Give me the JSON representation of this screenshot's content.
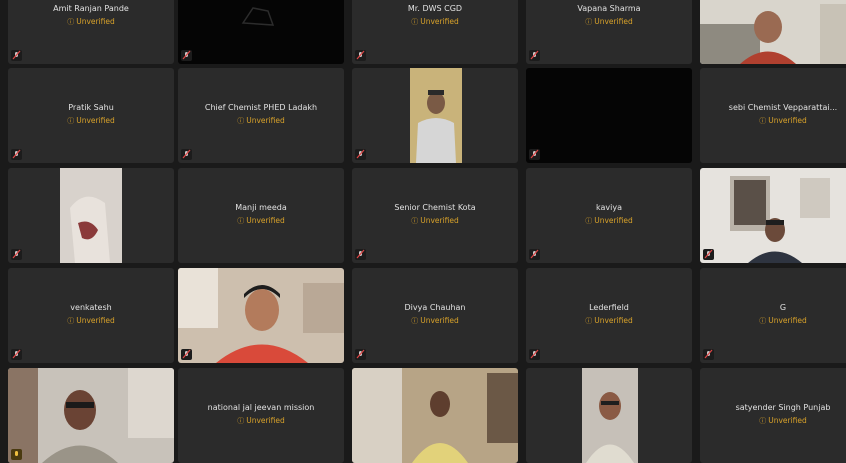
{
  "status_label": "Unverified",
  "participants": [
    {
      "name": "Amit Ranjan Pande",
      "status": "Unverified",
      "kind": "name"
    },
    {
      "name": "",
      "status": "",
      "kind": "black"
    },
    {
      "name": "Mr. DWS CGD",
      "status": "Unverified",
      "kind": "name"
    },
    {
      "name": "Vapana Sharma",
      "status": "Unverified",
      "kind": "name"
    },
    {
      "name": "",
      "status": "",
      "kind": "video"
    },
    {
      "name": "Pratik Sahu",
      "status": "Unverified",
      "kind": "name"
    },
    {
      "name": "Chief Chemist PHED Ladakh",
      "status": "Unverified",
      "kind": "name"
    },
    {
      "name": "",
      "status": "",
      "kind": "video"
    },
    {
      "name": "",
      "status": "",
      "kind": "black"
    },
    {
      "name": "sebi Chemist Vepparattai...",
      "status": "Unverified",
      "kind": "name"
    },
    {
      "name": "",
      "status": "",
      "kind": "video"
    },
    {
      "name": "Manji meeda",
      "status": "Unverified",
      "kind": "name"
    },
    {
      "name": "Senior Chemist Kota",
      "status": "Unverified",
      "kind": "name"
    },
    {
      "name": "kaviya",
      "status": "Unverified",
      "kind": "name"
    },
    {
      "name": "",
      "status": "",
      "kind": "video"
    },
    {
      "name": "venkatesh",
      "status": "Unverified",
      "kind": "name"
    },
    {
      "name": "",
      "status": "",
      "kind": "video"
    },
    {
      "name": "Divya Chauhan",
      "status": "Unverified",
      "kind": "name"
    },
    {
      "name": "Lederfield",
      "status": "Unverified",
      "kind": "name"
    },
    {
      "name": "G",
      "status": "Unverified",
      "kind": "name"
    },
    {
      "name": "",
      "status": "",
      "kind": "video"
    },
    {
      "name": "national jal jeevan mission",
      "status": "Unverified",
      "kind": "name"
    },
    {
      "name": "",
      "status": "",
      "kind": "video"
    },
    {
      "name": "",
      "status": "",
      "kind": "video"
    },
    {
      "name": "satyender Singh Punjab",
      "status": "Unverified",
      "kind": "name"
    }
  ]
}
